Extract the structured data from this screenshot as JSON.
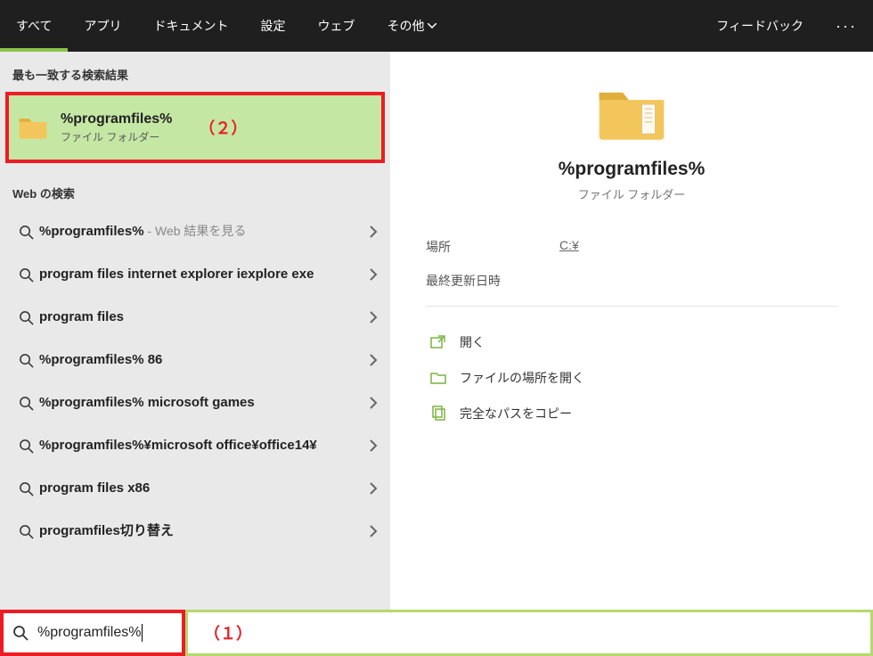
{
  "topbar": {
    "tabs": [
      "すべて",
      "アプリ",
      "ドキュメント",
      "設定",
      "ウェブ",
      "その他"
    ],
    "feedback": "フィードバック"
  },
  "left": {
    "best_label": "最も一致する検索結果",
    "best": {
      "title": "%programfiles%",
      "subtitle": "ファイル フォルダー",
      "annot": "（２）"
    },
    "web_label": "Web の検索",
    "web_rows": [
      {
        "q": "%programfiles%",
        "suffix": " - Web 結果を見る"
      },
      {
        "q": "program files internet explorer iexplore exe"
      },
      {
        "q": "program files"
      },
      {
        "q": "%programfiles% 86"
      },
      {
        "q": "%programfiles% microsoft games"
      },
      {
        "q": "%programfiles%¥microsoft office¥office14¥"
      },
      {
        "q": "program files x86"
      },
      {
        "q": "programfiles切り替え"
      }
    ]
  },
  "right": {
    "title": "%programfiles%",
    "subtitle": "ファイル フォルダー",
    "meta": {
      "location_k": "場所",
      "location_v": "C:¥",
      "updated_k": "最終更新日時"
    },
    "actions": {
      "open": "開く",
      "open_location": "ファイルの場所を開く",
      "copy_path": "完全なパスをコピー"
    }
  },
  "search": {
    "value": "%programfiles%",
    "annot": "（１）"
  }
}
